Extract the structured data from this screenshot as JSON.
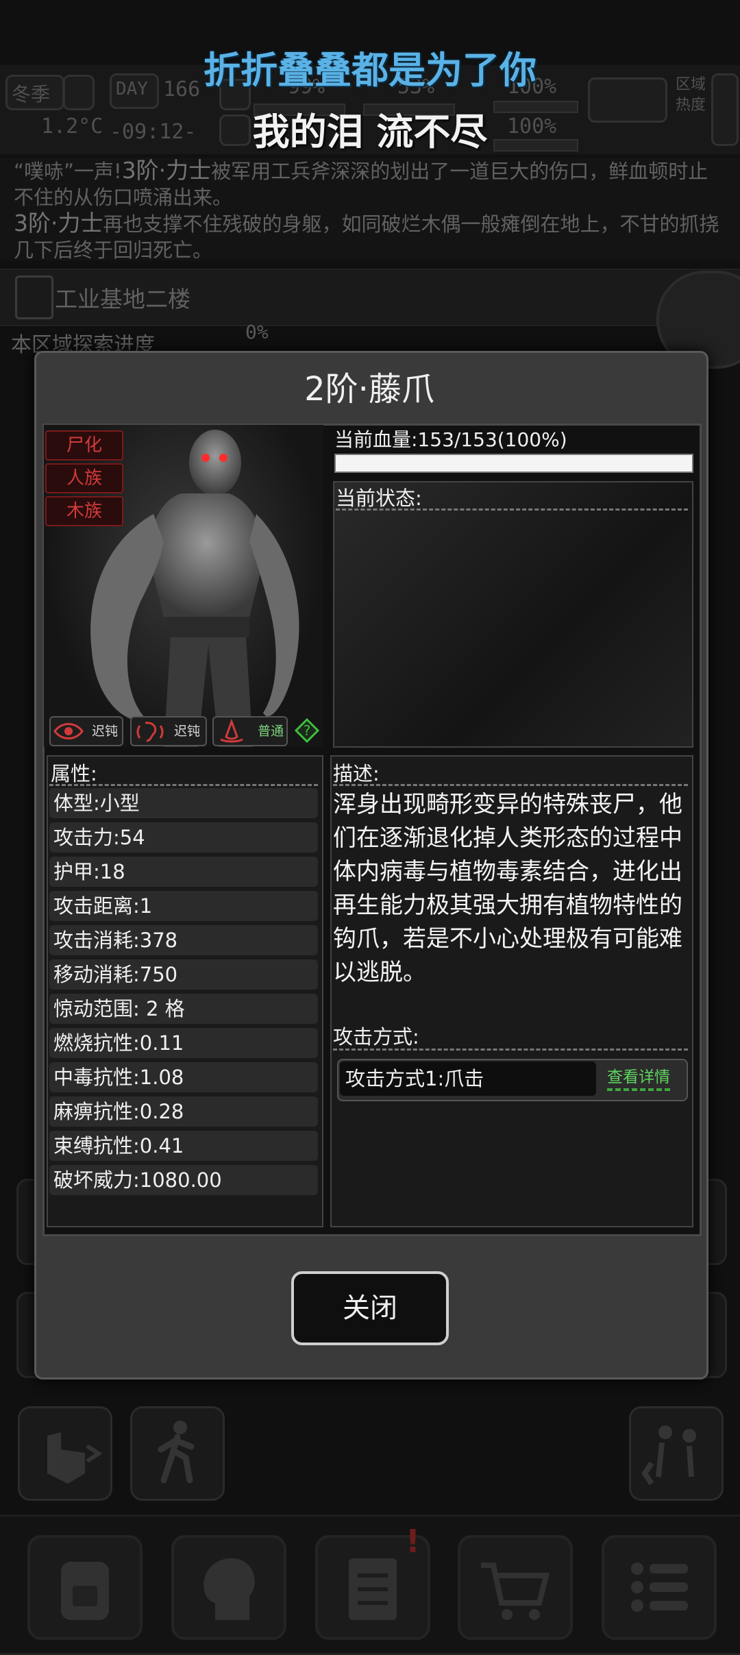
{
  "lyrics": {
    "line1": "折折叠叠都是为了你",
    "line2": "我的泪 流不尽"
  },
  "hud": {
    "season": "冬季",
    "temperature": "1.2°C",
    "day_label": "DAY",
    "day_number": "166",
    "clock": "-09:12-",
    "health_pct": "99%",
    "mood_pct": "53%",
    "stat3_pct": "100%",
    "stat4_pct": "100%",
    "region_label": "区域",
    "heat_label": "热度"
  },
  "log": {
    "line1_a": "“噗哧”一声!",
    "line1_b": "3阶·力士",
    "line1_c": "被军用工兵斧深深的划出了一道巨大的伤口，鲜血顿时止不住的从伤口喷涌出来。",
    "line2_a": "3阶·力士",
    "line2_b": "再也支撑不住残破的身躯，如同破烂木偶一般瘫倒在地上，不甘的抓挠几下后终于回归死亡。"
  },
  "location": {
    "name": "工业基地二楼",
    "explore_label": "本区域探索进度",
    "explore_pct": "0%"
  },
  "modal": {
    "title": "2阶·藤爪",
    "tags": [
      "尸化",
      "人族",
      "木族"
    ],
    "senses": [
      {
        "icon": "eye-icon",
        "label": "迟钝"
      },
      {
        "icon": "ear-icon",
        "label": "迟钝"
      },
      {
        "icon": "nose-icon",
        "label": "普通"
      }
    ],
    "hp_text": "当前血量:153/153(100%)",
    "hp_fraction": 1.0,
    "state_label": "当前状态:",
    "attr_label": "属性:",
    "attributes": [
      "体型:小型",
      "攻击力:54",
      "护甲:18",
      "攻击距离:1",
      "攻击消耗:378",
      "移动消耗:750",
      "惊动范围: 2 格",
      "燃烧抗性:0.11",
      "中毒抗性:1.08",
      "麻痹抗性:0.28",
      "束缚抗性:0.41",
      "破坏威力:1080.00"
    ],
    "desc_label": "描述:",
    "description": "浑身出现畸形变异的特殊丧尸，他们在逐渐退化掉人类形态的过程中体内病毒与植物毒素结合，进化出再生能力极其强大拥有植物特性的钩爪，若是不小心处理极有可能难以逃脱。",
    "attack_label": "攻击方式:",
    "attack_name": "攻击方式1:爪击",
    "attack_detail": "查看详情",
    "close_label": "关闭"
  },
  "colors": {
    "tag_red": "#d23a3a",
    "detail_green": "#5fd35f",
    "lyric_blue": "#5ab2e6"
  }
}
